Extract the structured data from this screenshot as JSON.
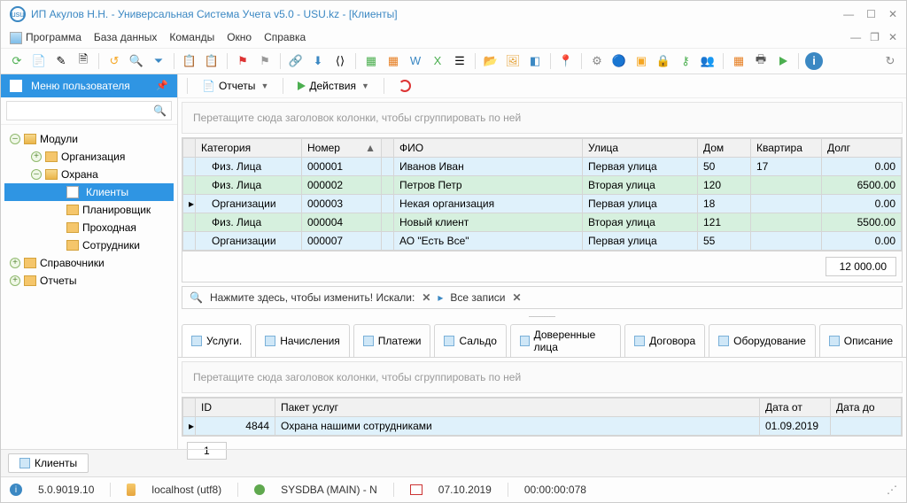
{
  "window": {
    "title": "ИП Акулов Н.Н. - Универсальная Система Учета v5.0 - USU.kz - [Клиенты]"
  },
  "menu": {
    "program": "Программа",
    "database": "База данных",
    "commands": "Команды",
    "window": "Окно",
    "help": "Справка"
  },
  "sidebar": {
    "header": "Меню пользователя",
    "items": {
      "modules": "Модули",
      "organization": "Организация",
      "security": "Охрана",
      "clients": "Клиенты",
      "planner": "Планировщик",
      "checkpoint": "Проходная",
      "employees": "Сотрудники",
      "references": "Справочники",
      "reports": "Отчеты"
    }
  },
  "content_toolbar": {
    "reports": "Отчеты",
    "actions": "Действия"
  },
  "group_hint": "Перетащите сюда заголовок колонки, чтобы сгруппировать по ней",
  "grid": {
    "columns": {
      "category": "Категория",
      "number": "Номер",
      "fio": "ФИО",
      "street": "Улица",
      "house": "Дом",
      "apartment": "Квартира",
      "debt": "Долг"
    },
    "rows": [
      {
        "category": "Физ. Лица",
        "number": "000001",
        "fio": "Иванов Иван",
        "street": "Первая улица",
        "house": "50",
        "apartment": "17",
        "debt": "0.00"
      },
      {
        "category": "Физ. Лица",
        "number": "000002",
        "fio": "Петров Петр",
        "street": "Вторая улица",
        "house": "120",
        "apartment": "",
        "debt": "6500.00"
      },
      {
        "category": "Организации",
        "number": "000003",
        "fio": "Некая организация",
        "street": "Первая улица",
        "house": "18",
        "apartment": "",
        "debt": "0.00"
      },
      {
        "category": "Физ. Лица",
        "number": "000004",
        "fio": "Новый клиент",
        "street": "Вторая улица",
        "house": "121",
        "apartment": "",
        "debt": "5500.00"
      },
      {
        "category": "Организации",
        "number": "000007",
        "fio": "АО \"Есть Все\"",
        "street": "Первая улица",
        "house": "55",
        "apartment": "",
        "debt": "0.00"
      }
    ],
    "total": "12 000.00"
  },
  "filter": {
    "label": "Нажмите здесь, чтобы изменить! Искали:",
    "all": "Все записи"
  },
  "tabs": {
    "services": "Услуги.",
    "accruals": "Начисления",
    "payments": "Платежи",
    "balance": "Сальдо",
    "trusted": "Доверенные лица",
    "contracts": "Договора",
    "equipment": "Оборудование",
    "description": "Описание"
  },
  "subgrid": {
    "columns": {
      "id": "ID",
      "package": "Пакет услуг",
      "date_from": "Дата от",
      "date_to": "Дата до"
    },
    "rows": [
      {
        "id": "4844",
        "package": "Охрана нашими сотрудниками",
        "date_from": "01.09.2019",
        "date_to": ""
      }
    ],
    "page": "1"
  },
  "doc_tab": "Клиенты",
  "status": {
    "version": "5.0.9019.10",
    "host": "localhost (utf8)",
    "user": "SYSDBA (MAIN) - N",
    "date": "07.10.2019",
    "time": "00:00:00:078"
  }
}
